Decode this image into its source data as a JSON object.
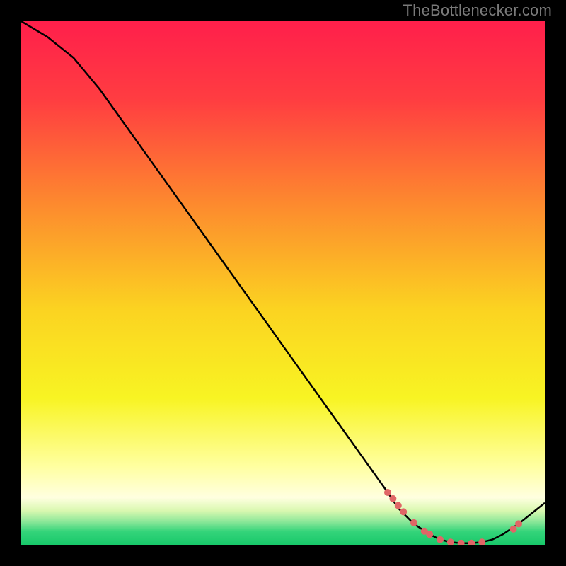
{
  "watermark": "TheBottlenecker.com",
  "chart_data": {
    "type": "line",
    "title": "",
    "xlabel": "",
    "ylabel": "",
    "xlim": [
      0,
      100
    ],
    "ylim": [
      0,
      100
    ],
    "x": [
      0,
      5,
      10,
      15,
      20,
      25,
      30,
      35,
      40,
      45,
      50,
      55,
      60,
      65,
      70,
      72,
      75,
      78,
      80,
      82,
      84,
      86,
      88,
      90,
      92,
      95,
      100
    ],
    "y": [
      100,
      97,
      93,
      87,
      80,
      73,
      66,
      59,
      52,
      45,
      38,
      31,
      24,
      17,
      10,
      7,
      4,
      2,
      1,
      0.5,
      0.3,
      0.3,
      0.5,
      1,
      2,
      4,
      8
    ],
    "dots": {
      "x": [
        70,
        71,
        72,
        73,
        75,
        77,
        78,
        80,
        82,
        84,
        86,
        88,
        94,
        95
      ],
      "y": [
        10,
        8.8,
        7.5,
        6.3,
        4.2,
        2.6,
        2.0,
        1.0,
        0.5,
        0.3,
        0.3,
        0.5,
        3.0,
        4.0
      ]
    },
    "gradient_stops": [
      {
        "offset": 0.0,
        "color": "#ff1f4b"
      },
      {
        "offset": 0.15,
        "color": "#ff3d41"
      },
      {
        "offset": 0.35,
        "color": "#fd8a2e"
      },
      {
        "offset": 0.55,
        "color": "#fbd321"
      },
      {
        "offset": 0.72,
        "color": "#f8f423"
      },
      {
        "offset": 0.85,
        "color": "#ffffa0"
      },
      {
        "offset": 0.91,
        "color": "#ffffe0"
      },
      {
        "offset": 0.935,
        "color": "#d9f8b0"
      },
      {
        "offset": 0.955,
        "color": "#8fe89a"
      },
      {
        "offset": 0.975,
        "color": "#34d47a"
      },
      {
        "offset": 1.0,
        "color": "#18c86a"
      }
    ],
    "curve_color": "#000000",
    "dot_color": "#e06666"
  }
}
